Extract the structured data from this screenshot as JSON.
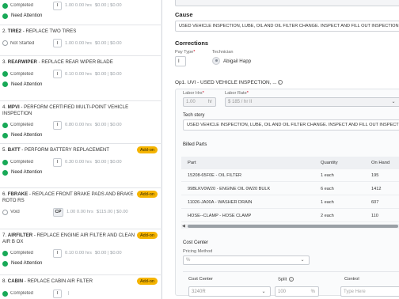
{
  "operations": [
    {
      "num": "1.",
      "code": "",
      "desc": "",
      "status": "Completed",
      "status_kind": "completed",
      "box": "I",
      "qty": "1.00",
      "hrs": "0.00 hrs",
      "price": "$0.00",
      "total": "$0.00",
      "addon": "",
      "attention": "Need Attention"
    },
    {
      "num": "2.",
      "code": "TIRE2",
      "desc": " - REPLACE TWO TIRES",
      "status": "Not Started",
      "status_kind": "notstarted",
      "box": "I",
      "qty": "1.00",
      "hrs": "0.00 hrs",
      "price": "$0.00",
      "total": "$0.00",
      "addon": "",
      "attention": ""
    },
    {
      "num": "3.",
      "code": "REARWIPER",
      "desc": " - REPLACE REAR WIPER BLADE",
      "status": "Completed",
      "status_kind": "completed",
      "box": "I",
      "qty": "0.10",
      "hrs": "0.00 hrs",
      "price": "$0.00",
      "total": "$0.00",
      "addon": "",
      "attention": "Need Attention"
    },
    {
      "num": "4.",
      "code": "MPVI",
      "desc": " - PERFORM CERTIFIED MULTI-POINT VEHICLE INSPECTION",
      "status": "Completed",
      "status_kind": "completed",
      "box": "I",
      "qty": "0.80",
      "hrs": "0.00 hrs",
      "price": "$0.00",
      "total": "$0.00",
      "addon": "",
      "attention": "Need Attention"
    },
    {
      "num": "5.",
      "code": "BATT",
      "desc": " - PERFORM BATTERY REPLACEMENT",
      "status": "Completed",
      "status_kind": "completed",
      "box": "I",
      "qty": "0.30",
      "hrs": "0.00 hrs",
      "price": "$0.00",
      "total": "$0.00",
      "addon": "Add-on",
      "attention": "Need Attention"
    },
    {
      "num": "6.",
      "code": "FBRAKE",
      "desc": " - REPLACE FRONT BRAKE PADS AND BRAKE ROTO RS",
      "status": "Void",
      "status_kind": "void",
      "box": "CP",
      "qty": "1.00",
      "hrs": "0.00 hrs",
      "price": "$115.00",
      "total": "$0.00",
      "addon": "Add-on",
      "attention": ""
    },
    {
      "num": "7.",
      "code": "AIRFILTER",
      "desc": " - REPLACE ENGINE AIR FILTER AND CLEAN AIR B OX",
      "status": "Completed",
      "status_kind": "completed",
      "box": "I",
      "qty": "0.10",
      "hrs": "0.00 hrs",
      "price": "$0.00",
      "total": "$0.00",
      "addon": "Add-on",
      "attention": "Need Attention"
    },
    {
      "num": "8.",
      "code": "CABIN",
      "desc": " - REPLACE CABIN AIR FILTER",
      "status": "Completed",
      "status_kind": "completed",
      "box": "I",
      "qty": "",
      "hrs": "",
      "price": "",
      "total": "",
      "addon": "Add-on",
      "attention": ""
    }
  ],
  "detail": {
    "cause_heading": "Cause",
    "cause_text": "USED VEHICLE INSPECTION, LUBE, OIL AND OIL FILTER CHANGE. INSPECT AND FILL OUT INSPECTION FO",
    "corrections_heading": "Corrections",
    "pay_type_label": "Pay Type",
    "pay_type_value": "I",
    "technician_label": "Technician",
    "technician_name": "Abigail Happ",
    "op_heading": "Op1. UVI - USED VEHICLE INSPECTION, ...",
    "info_glyph": "i",
    "labor_hrs_label": "Labor Hrs",
    "labor_hrs_value": "1.00",
    "labor_hrs_unit": "hr",
    "labor_rate_label": "Labor Rate",
    "labor_rate_value": "$ 185 / hr II",
    "tech_story_label": "Tech story",
    "tech_story_text": "USED VEHICLE INSPECTION, LUBE, OIL AND OIL FILTER CHANGE. INSPECT AND FILL OUT INSPECTION FO",
    "billed_parts_label": "Billed Parts",
    "parts_columns": [
      "Part",
      "Quantity",
      "On Hand"
    ],
    "parts": [
      {
        "part": "15208-65F0E - OIL FILTER",
        "quantity": "1 each",
        "on_hand": "195"
      },
      {
        "part": "99BLKV0W20 - ENGINE OIL 0W20 BULK",
        "quantity": "6 each",
        "on_hand": "1412"
      },
      {
        "part": "11026-JA00A - WASHER DRAIN",
        "quantity": "1 each",
        "on_hand": "607"
      },
      {
        "part": "HOSE--CLAMP - HOSE CLAMP",
        "quantity": "2 each",
        "on_hand": "110"
      }
    ],
    "cost_center_label": "Cost Center",
    "pricing_method_label": "Pricing Method",
    "pricing_method_value": "%",
    "cc_columns": [
      "Cost Center",
      "Split",
      "Control"
    ],
    "cc_value": "3240R",
    "split_value": "100",
    "split_unit": "%",
    "control_placeholder": "Type Here"
  }
}
